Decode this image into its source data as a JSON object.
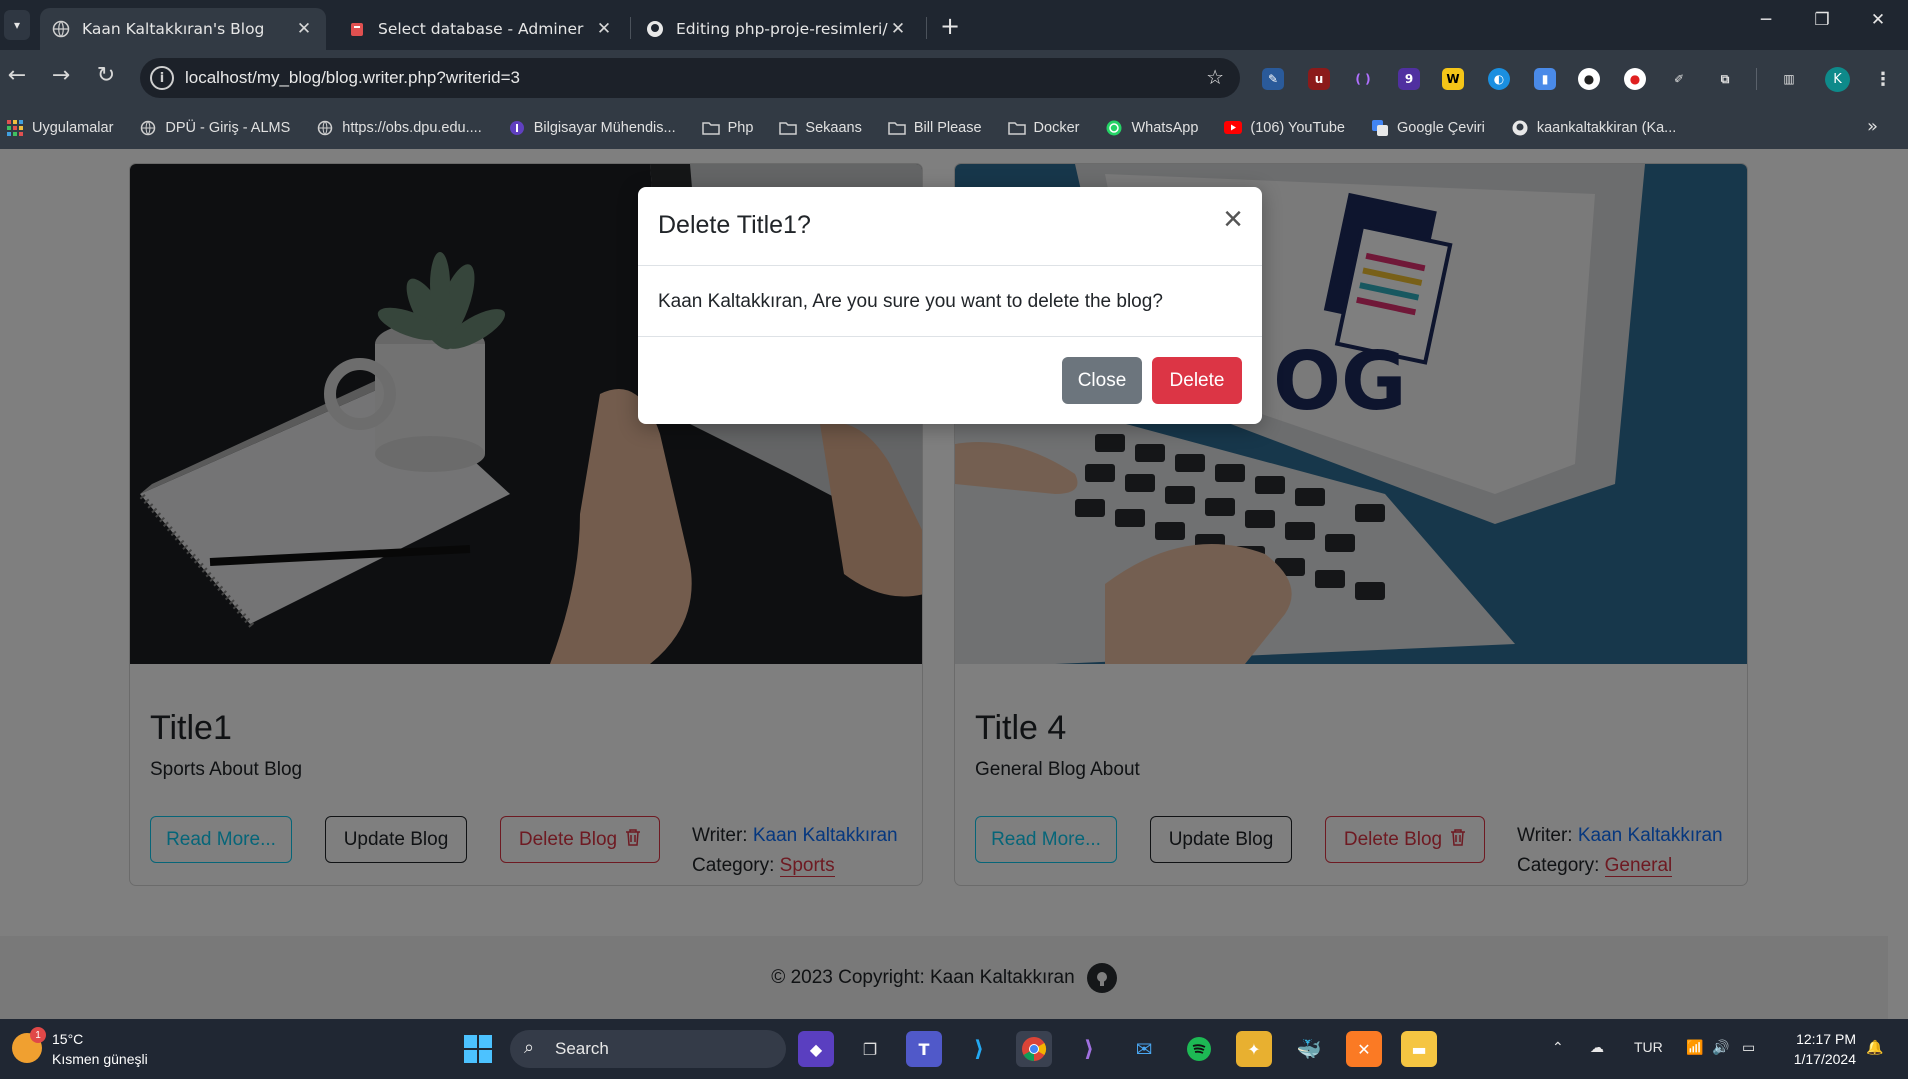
{
  "browser": {
    "tabs": [
      {
        "label": "Kaan Kaltakkıran's Blog",
        "active": true
      },
      {
        "label": "Select database - Adminer",
        "active": false
      },
      {
        "label": "Editing php-proje-resimleri/blo",
        "active": false
      }
    ],
    "close_glyph": "✕",
    "new_tab_glyph": "+",
    "url": "localhost/my_blog/blog.writer.php?writerid=3",
    "profile_initial": "K",
    "ext_badge_count": "9",
    "bookmarks": [
      {
        "label": "Uygulamalar",
        "icon": "apps-grid-icon"
      },
      {
        "label": "DPÜ - Giriş - ALMS",
        "icon": "globe-icon"
      },
      {
        "label": "https://obs.dpu.edu....",
        "icon": "globe-icon"
      },
      {
        "label": "Bilgisayar Mühendis...",
        "icon": "info-icon"
      },
      {
        "label": "Php",
        "icon": "folder-icon"
      },
      {
        "label": "Sekaans",
        "icon": "folder-icon"
      },
      {
        "label": "Bill Please",
        "icon": "folder-icon"
      },
      {
        "label": "Docker",
        "icon": "folder-icon"
      },
      {
        "label": "WhatsApp",
        "icon": "whatsapp-icon"
      },
      {
        "label": "(106) YouTube",
        "icon": "youtube-icon"
      },
      {
        "label": "Google Çeviri",
        "icon": "google-translate-icon"
      },
      {
        "label": "kaankaltakkiran (Ka...",
        "icon": "github-icon"
      }
    ]
  },
  "cards": [
    {
      "title": "Title1",
      "subtitle": "Sports About Blog",
      "read_more": "Read More...",
      "update": "Update Blog",
      "delete": "Delete Blog",
      "writer_label": "Writer:",
      "writer": "Kaan Kaltakkıran",
      "category_label": "Category:",
      "category": "Sports"
    },
    {
      "title": "Title 4",
      "subtitle": "General Blog About",
      "read_more": "Read More...",
      "update": "Update Blog",
      "delete": "Delete Blog",
      "writer_label": "Writer:",
      "writer": "Kaan Kaltakkıran",
      "category_label": "Category:",
      "category": "General"
    }
  ],
  "card2_image_text": "OG",
  "footer": {
    "text": "© 2023 Copyright: Kaan Kaltakkıran"
  },
  "modal": {
    "title": "Delete Title1?",
    "body": "Kaan Kaltakkıran, Are you sure you want to delete the blog?",
    "close": "Close",
    "delete": "Delete"
  },
  "taskbar": {
    "weather_temp": "15°C",
    "weather_desc": "Kısmen güneşli",
    "weather_badge": "1",
    "search_label": "Search",
    "language": "TUR",
    "time": "12:17 PM",
    "date": "1/17/2024"
  },
  "colors": {
    "info": "#0dcaf0",
    "danger": "#dc3545",
    "secondary": "#6c757d",
    "link": "#0d6efd"
  }
}
